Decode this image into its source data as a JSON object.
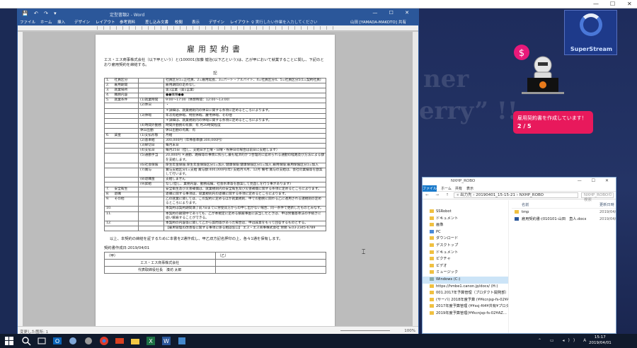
{
  "top_window_controls": [
    "—",
    "☐",
    "✕"
  ],
  "word": {
    "quick_access": "💾 ↶ ↷ ▾",
    "title": "定型書類2 - Word",
    "window_controls": "— ☐ ✕",
    "tabs": [
      "ファイル",
      "ホーム",
      "挿入",
      "デザイン",
      "レイアウト",
      "参考資料",
      "差し込み文書",
      "校閲",
      "表示",
      "デザイン",
      "レイアウト"
    ],
    "search": "♀ 実行したい作業を入力してください",
    "user": "山田 [YAMADA-MAKOTO]",
    "share": "共有",
    "status_left": "変更した箇所: 1",
    "zoom": "100%"
  },
  "document": {
    "title": "雇用契約書",
    "intro": "エス・エス商事株式会社（以下甲という）と(100001)加藤 健治(以下乙という)は、乙が甲において就業することに関し、下記のとおり雇用契約を締結する。",
    "ki": "記",
    "table": [
      [
        "1.",
        "社員区分",
        "",
        "社員区分1=正社員、2=雇用延長、3=パート・アルバイト、4=社員区分4、5=社員区分5(1=契約社員)"
      ],
      [
        "2.",
        "雇用期間",
        "",
        "雇用期間の定めなし"
      ],
      [
        "3.",
        "就業場所",
        "",
        "第1営業（第1営業）"
      ],
      [
        "4.",
        "職務内容",
        "",
        "●●職種●●"
      ],
      [
        "5.",
        "就業条件",
        "(1)就業時間",
        "9:00～17:00（休憩時間：12:00～13:00）"
      ],
      [
        "",
        "",
        "(2)休日",
        "・"
      ],
      [
        "",
        "",
        "",
        "＊詳細は、就業規則内の休日に関する条項に定めるところによります。"
      ],
      [
        "",
        "",
        "(3)休暇",
        "年次有給休暇、特別休暇、慶弔休暇、その他"
      ],
      [
        "",
        "",
        "",
        "＊詳細は、就業規則内の休暇に関する条項に定めるところによります。"
      ],
      [
        "",
        "",
        "(4)時間外勤務",
        "時間外勤務の有無：有 月20時間程度"
      ],
      [
        "",
        "",
        "休日出勤",
        "休日出勤の有無：有"
      ],
      [
        "6.",
        "賃金",
        "(1)支払形態",
        "月給"
      ],
      [
        "",
        "",
        "(2)基本給",
        "300,000円（年俸基準額:300,000円）"
      ],
      [
        "",
        "",
        "(3)締切日",
        "毎月末日"
      ],
      [
        "",
        "",
        "(4)支払日",
        "毎月25日（但し、支給日が土曜・日曜・祝祭日の場合は前日に支給します）"
      ],
      [
        "",
        "",
        "(5)通勤手当",
        "20,000円 ＊通勤、路線等の事情に照らし最も経済的かつ合理的に認められる通勤の経路及び方法による額を支給します。"
      ],
      [
        "",
        "",
        "(6)社会保険",
        "厚生年金保険:厚生年金保険区分1=加入 健康保険:健康保険区分1=加入 雇用保険:雇用保険区分1=加入"
      ],
      [
        "",
        "",
        "(7)賞与",
        "賞与支給区分1=支給 賞与額:400,000円(年) 支給月:6月、12月 備考:賞与の支給は、会社の業績等を勘案して行います。"
      ],
      [
        "",
        "",
        "(8)退職金",
        "支給しません"
      ],
      [
        "",
        "",
        "(9)昇給",
        "なし(但し、業務内容、勤務成績、社会水準等を勘案して見直しを行う事があります)"
      ],
      [
        "7.",
        "安全衛生",
        "",
        "安全衛生及び災害補償は、就業規則内の安全衛生及び災害補償に関する条項に定めるところによります。"
      ],
      [
        "8.",
        "退職",
        "",
        "退職に関する事項は、就業規則内の退職に関する条項に定めるところによります。"
      ],
      [
        "9.",
        "その他",
        "",
        "乙の就業に関しては、この契約に定めるほか就業規則、甲での勤務に関わる乙に適用される諸規則の定めるところによります。"
      ],
      [
        "10.",
        "",
        "",
        "本契約は契約期間満了前7日までに労使双方からの申し出がない場合、同一条件で更新したものとみなす。"
      ],
      [
        "11.",
        "",
        "",
        "本契約の期間中であっても、乙が本規定に定める解雇事由に該当したときは、甲は労働基準法の手続きに従い解雇することができる。"
      ],
      [
        "12.",
        "",
        "",
        "本契約の内容等に関して乙から質問等があった場合は、甲は誠意をもって回答するものとする。"
      ],
      [
        "",
        "",
        "",
        "【雇用管理の改善等に関する事項に係る相談窓口】 エス・エス商事株式会社 労務 ℡03-2345-6789"
      ]
    ],
    "closing": "以上、本契約の締結を証するために本書を2通作成し、甲乙双方記名押印の上、各々1通を保有します。",
    "date": "契約書作成日:2019/04/01",
    "sig_left_label": "（甲）",
    "sig_left_company": "エス・エス商事株式会社",
    "sig_left_rep": "代表取締役社長　湊坊 太郎",
    "sig_right_label": "（乙）"
  },
  "bg_text_1": "ner",
  "bg_text_2": "erry” !!",
  "superstream": "SuperStream",
  "bubble": {
    "line": "雇用契約書を作成しています！",
    "count": "2 / 5"
  },
  "explorer": {
    "title": "NXHP_ROBO",
    "window_controls": "— ☐ ✕",
    "ribbon": [
      "ファイル",
      "ホーム",
      "共有",
      "表示"
    ],
    "nav_arrows": "← → ↑",
    "path": "« 出力先 › 20190401_15-15-21 › NXHP_ROBO",
    "search": "NXHP_ROBOの検索",
    "nav": [
      "SSRobot",
      "ドキュメント",
      "画像",
      "PC",
      "ダウンロード",
      "デスクトップ",
      "ドキュメント",
      "ピクチャ",
      "ビデオ",
      "ミュージック",
      "Windows (C:)",
      "https://hmbe1.canon.jp/docs/ (H:)",
      "001.2017年予算管理（プロダクト開発部）",
      "(サーバ) 2018年度予算 (¥¥kcnjsp-fs-02¥AZ…",
      "2017年度予算管理 (¥¥ssj-fil4¥共有¥プロダクト…",
      "2019年度予算管理(¥¥kcnjsp-fs-02¥AZ…"
    ],
    "col_name": "名前",
    "col_date": "更新日時",
    "files": [
      {
        "name": "tmp",
        "date": "2019/04/0",
        "icon": "folder"
      },
      {
        "name": "雇用契約書-(010101-山田　直人.docx",
        "date": "2019/04/0",
        "icon": "word"
      }
    ]
  },
  "clock": {
    "time": "15:17",
    "date": "2019/04/01"
  },
  "tray": "⌃ ▭ ◂)) A",
  "cursor": "⌶"
}
